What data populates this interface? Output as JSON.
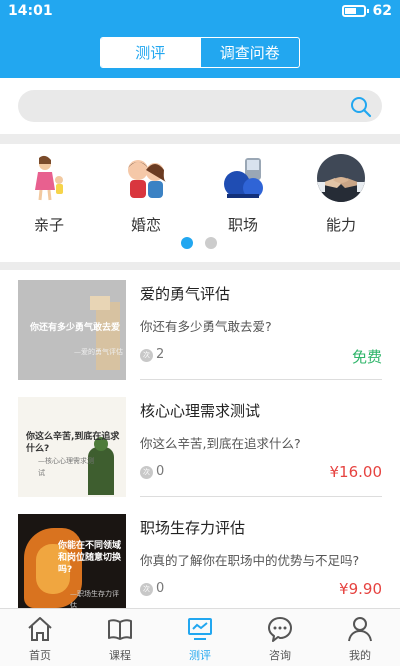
{
  "status_bar": {
    "time": "14:01",
    "battery_level": "62",
    "battery_fraction": 0.62
  },
  "header": {
    "tabs": [
      {
        "label": "测评",
        "active": true
      },
      {
        "label": "调查问卷",
        "active": false
      }
    ]
  },
  "search": {
    "placeholder": "",
    "icon": "search-icon"
  },
  "categories": [
    {
      "label": "亲子",
      "icon": "parent-child-icon"
    },
    {
      "label": "婚恋",
      "icon": "couple-icon"
    },
    {
      "label": "职场",
      "icon": "workplace-icon"
    },
    {
      "label": "能力",
      "icon": "handshake-icon"
    }
  ],
  "pager": {
    "pages": 2,
    "current": 1
  },
  "tests": [
    {
      "title": "爱的勇气评估",
      "subtitle": "你还有多少勇气敢去爱?",
      "count": "2",
      "price": "免费",
      "thumb_text": "你还有多少勇气敢去爱",
      "thumb_subtext": "—爱的勇气评估"
    },
    {
      "title": "核心心理需求测试",
      "subtitle": "你这么辛苦,到底在追求什么?",
      "count": "0",
      "price": "¥16.00",
      "thumb_text": "你这么辛苦,到底在追求什么?",
      "thumb_subtext": "—核心心理需求测试"
    },
    {
      "title": "职场生存力评估",
      "subtitle": "你真的了解你在职场中的优势与不足吗?",
      "count": "0",
      "price": "¥9.90",
      "thumb_text": "你能在不同领域和岗位随意切换吗?",
      "thumb_subtext": "—职场生存力评估"
    }
  ],
  "count_icon_text": "次",
  "tabbar": [
    {
      "label": "首页",
      "icon": "home-icon",
      "active": false
    },
    {
      "label": "课程",
      "icon": "book-icon",
      "active": false
    },
    {
      "label": "测评",
      "icon": "monitor-icon",
      "active": true
    },
    {
      "label": "咨询",
      "icon": "chat-icon",
      "active": false
    },
    {
      "label": "我的",
      "icon": "user-icon",
      "active": false
    }
  ],
  "colors": {
    "primary": "#22a7f0",
    "free": "#2fb56a",
    "price": "#e64340",
    "dot_inactive": "#cccccc"
  }
}
